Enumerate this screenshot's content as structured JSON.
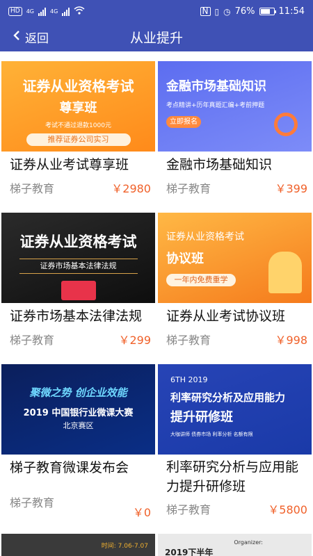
{
  "status": {
    "carrier_badge": "HD",
    "net1": "4G",
    "net2": "4G",
    "battery": "76%",
    "time": "11:54"
  },
  "nav": {
    "back_label": "返回",
    "title": "从业提升"
  },
  "cards": [
    {
      "title": "证券从业考试尊享班",
      "org": "梯子教育",
      "price": "￥2980",
      "thumb_line1": "证券从业资格考试",
      "thumb_line2": "尊享班",
      "thumb_line3": "考试不通过退款1000元",
      "thumb_line4": "推荐证券公司实习"
    },
    {
      "title": "金融市场基础知识",
      "org": "梯子教育",
      "price": "￥399",
      "thumb_line1": "金融市场基础知识",
      "thumb_line2": "考点精讲+历年真题汇编+考前押题",
      "thumb_line3": "立即报名"
    },
    {
      "title": "证券市场基本法律法规",
      "org": "梯子教育",
      "price": "￥299",
      "thumb_line1": "证券从业资格考试",
      "thumb_line2": "证券市场基本法律法规"
    },
    {
      "title": "证券从业考试协议班",
      "org": "梯子教育",
      "price": "￥998",
      "thumb_line1": "证券从业资格考试",
      "thumb_line2": "协议班",
      "thumb_line3": "一年内免费重学"
    },
    {
      "title": "梯子教育微课发布会",
      "org": "梯子教育",
      "price": "￥0",
      "thumb_line1": "聚微之势  创企业效能",
      "thumb_line2": "2019 中国银行业微课大赛",
      "thumb_line3": "北京赛区"
    },
    {
      "title": "利率研究分析与应用能力提升研修班",
      "org": "梯子教育",
      "price": "￥5800",
      "thumb_line1": "6TH 2019",
      "thumb_line2": "利率研究分析及应用能力",
      "thumb_line3": "提升研修班",
      "thumb_line4": "大咖讲师  债券市场  利率分析  名额有限"
    }
  ],
  "partial": {
    "t7_text": "时间: 7.06-7.07",
    "t8_text": "2019下半年",
    "t8_org": "Organizer:"
  }
}
